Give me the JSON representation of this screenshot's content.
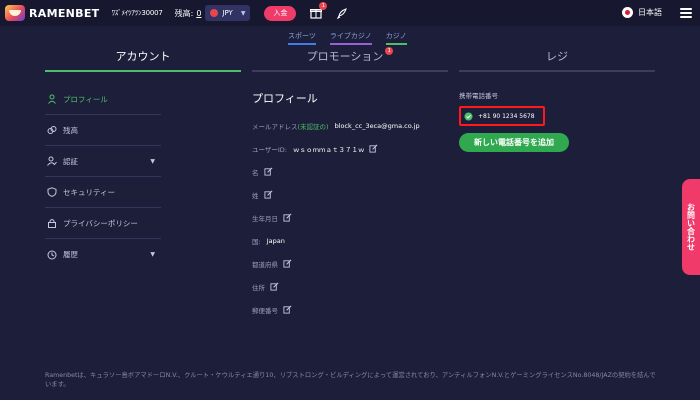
{
  "header": {
    "logo_text": "RAMENBET",
    "user_id": "ﾜｽﾞﾒｲﾂｱﾂﾝ30007",
    "balance_label": "残高:",
    "balance_value": "0",
    "currency": "JPY",
    "deposit_label": "入金",
    "gift_badge": "1",
    "language": "日本語"
  },
  "subnav": [
    "スポーツ",
    "ライブカジノ",
    "カジノ"
  ],
  "tabs": {
    "account": "アカウント",
    "promotion": "プロモーション",
    "promotion_badge": "1",
    "register": "レジ"
  },
  "sidebar": {
    "items": [
      {
        "label": "プロフィール",
        "icon": "user-icon"
      },
      {
        "label": "残高",
        "icon": "coins-icon"
      },
      {
        "label": "認証",
        "icon": "user-check-icon"
      },
      {
        "label": "セキュリティー",
        "icon": "shield-icon"
      },
      {
        "label": "プライバシーポリシー",
        "icon": "lock-icon"
      },
      {
        "label": "履歴",
        "icon": "history-icon"
      }
    ]
  },
  "profile": {
    "title": "プロフィール",
    "email_label": "メールアドレス",
    "email_status": "(未認証の)",
    "email_value": "block_cc_3eca@gma.co.jp",
    "userid_label": "ユーザーID:",
    "userid_value": "ｗｓｏｍｍａｔ３７１ｗ",
    "fields": [
      "名",
      "姓",
      "生年月日",
      "国:",
      "都道府県",
      "住所",
      "郵便番号"
    ],
    "country_value": "Japan"
  },
  "phone": {
    "label": "携帯電話番号",
    "value": "+81 90 1234 5678",
    "add_label": "新しい電話番号を追加"
  },
  "contact_label": "お問い合わせ",
  "footer": {
    "text": "Ramenbetは、キュラソー島ボアマドーロN.V.、クルート・ケウルティエ通り10、リブストロング・ビルディングによって運営されており、アンティルフォンN.V.とゲーミングライセンスNo.8048/JAZの契約を結んでいます。"
  },
  "colors": {
    "background": "#1d1f3a",
    "accent_green": "#4bc06a",
    "accent_pink": "#f03a6a",
    "highlight_red": "#ff1a1a"
  }
}
